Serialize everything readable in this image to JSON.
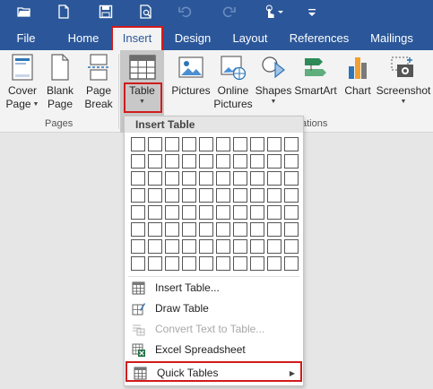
{
  "tabs": [
    {
      "label": "File"
    },
    {
      "label": "Home"
    },
    {
      "label": "Insert"
    },
    {
      "label": "Design"
    },
    {
      "label": "Layout"
    },
    {
      "label": "References"
    },
    {
      "label": "Mailings"
    }
  ],
  "ribbon": {
    "cover_page": {
      "line1": "Cover",
      "line2": "Page"
    },
    "blank_page": {
      "line1": "Blank",
      "line2": "Page"
    },
    "page_break": {
      "line1": "Page",
      "line2": "Break"
    },
    "table": {
      "label": "Table"
    },
    "pictures": {
      "label": "Pictures"
    },
    "online_pictures": {
      "line1": "Online",
      "line2": "Pictures"
    },
    "shapes": {
      "label": "Shapes"
    },
    "smartart": {
      "label": "SmartArt"
    },
    "chart": {
      "label": "Chart"
    },
    "screenshot": {
      "label": "Screenshot"
    },
    "groups": {
      "pages": "Pages",
      "illustrations_partial": "ations"
    }
  },
  "dropdown": {
    "header": "Insert Table",
    "grid": {
      "rows": 8,
      "cols": 10
    },
    "items": [
      {
        "label": "Insert Table...",
        "icon": "insert-table-icon",
        "disabled": false
      },
      {
        "label": "Draw Table",
        "icon": "draw-table-icon",
        "disabled": false
      },
      {
        "label": "Convert Text to Table...",
        "icon": "convert-text-icon",
        "disabled": true
      },
      {
        "label": "Excel Spreadsheet",
        "icon": "excel-spreadsheet-icon",
        "disabled": false
      },
      {
        "label": "Quick Tables",
        "icon": "quick-tables-icon",
        "disabled": false,
        "submenu": true
      }
    ]
  },
  "colors": {
    "titlebar_blue": "#2b579a",
    "highlight_red": "#d11b1b",
    "ribbon_bg": "#f3f3f3",
    "excel_green": "#1e7145"
  }
}
